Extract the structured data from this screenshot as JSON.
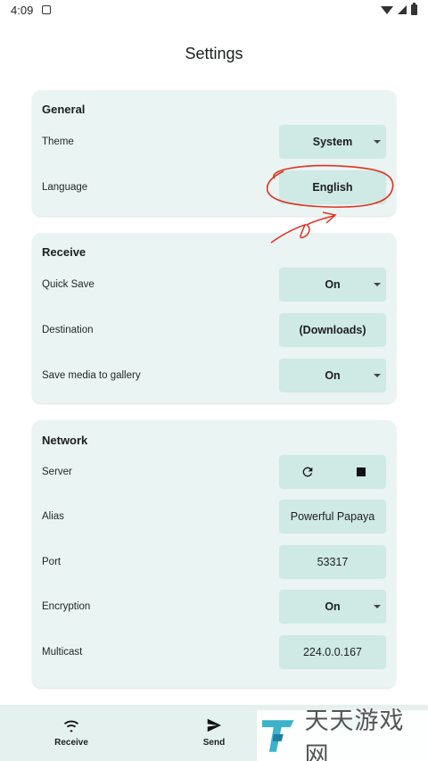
{
  "status": {
    "time": "4:09"
  },
  "page_title": "Settings",
  "general": {
    "title": "General",
    "theme": {
      "label": "Theme",
      "value": "System"
    },
    "language": {
      "label": "Language",
      "value": "English"
    }
  },
  "receive": {
    "title": "Receive",
    "quick_save": {
      "label": "Quick Save",
      "value": "On"
    },
    "destination": {
      "label": "Destination",
      "value": "(Downloads)"
    },
    "save_media": {
      "label": "Save media to gallery",
      "value": "On"
    }
  },
  "network": {
    "title": "Network",
    "server": {
      "label": "Server"
    },
    "alias": {
      "label": "Alias",
      "value": "Powerful Papaya"
    },
    "port": {
      "label": "Port",
      "value": "53317"
    },
    "encryption": {
      "label": "Encryption",
      "value": "On"
    },
    "multicast": {
      "label": "Multicast",
      "value": "224.0.0.167"
    }
  },
  "nav": {
    "receive": "Receive",
    "send": "Send"
  },
  "watermark": {
    "text": "天天游戏网"
  },
  "icons": {
    "wifi": "wifi-icon",
    "signal": "signal-icon",
    "battery": "battery-icon",
    "refresh": "refresh-icon",
    "stop": "stop-icon",
    "send": "send-icon"
  },
  "colors": {
    "card": "#eaf4f2",
    "control": "#cfe9e5",
    "annotation": "#e0321e",
    "nav": "#e5f1ef"
  }
}
